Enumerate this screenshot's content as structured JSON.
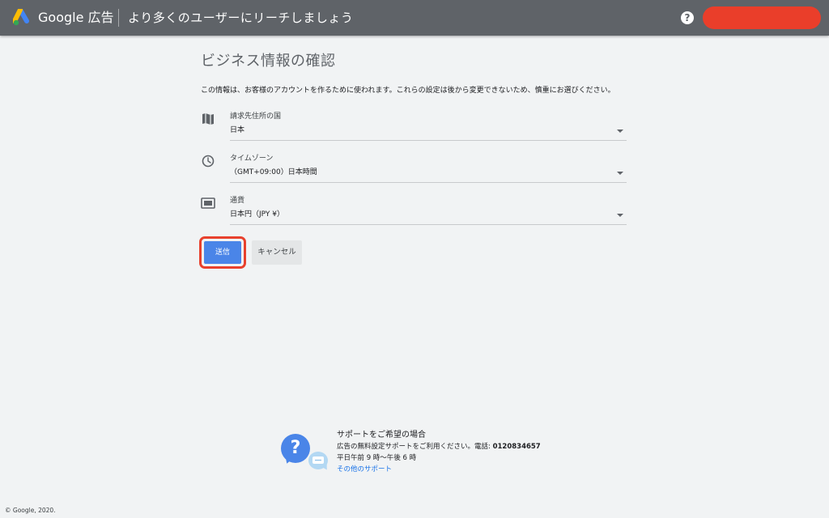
{
  "header": {
    "brand": "Google 広告",
    "title": "より多くのユーザーにリーチしましょう",
    "help_glyph": "?",
    "colors": {
      "bar": "#5f6368",
      "account_button": "#ea3e2a"
    }
  },
  "main": {
    "page_title": "ビジネス情報の確認",
    "description": "この情報は、お客様のアカウントを作るために使われます。これらの設定は後から変更できないため、慎重にお選びください。",
    "fields": [
      {
        "label": "請求先住所の国",
        "value": "日本",
        "icon": "map-icon"
      },
      {
        "label": "タイムゾーン",
        "value": "（GMT+09:00）日本時間",
        "icon": "clock-icon"
      },
      {
        "label": "通貨",
        "value": "日本円（JPY ¥）",
        "icon": "currency-icon"
      }
    ],
    "submit_label": "送信",
    "cancel_label": "キャンセル",
    "colors": {
      "submit": "#4a85e8",
      "highlight": "#e8412d"
    }
  },
  "support": {
    "heading": "サポートをご希望の場合",
    "text": "広告の無料設定サポートをご利用ください。電話: ",
    "phone": "0120834657",
    "hours": "平日午前 9 時〜午後 6 時",
    "link": "その他のサポート",
    "bubble_glyph": "?"
  },
  "footer": {
    "copyright": "© Google, 2020."
  }
}
